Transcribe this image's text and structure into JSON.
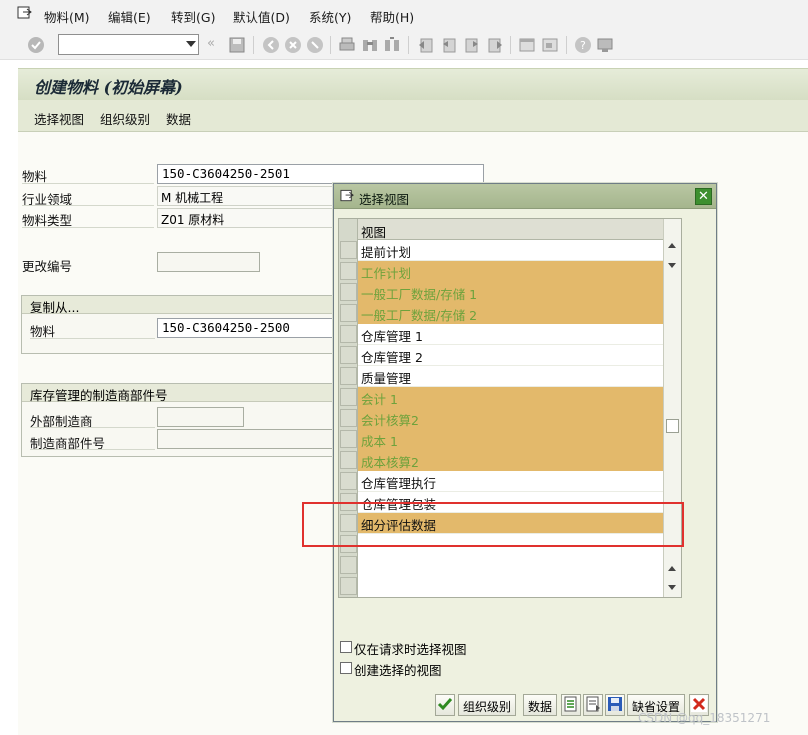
{
  "menubar": {
    "items": [
      "物料(M)",
      "编辑(E)",
      "转到(G)",
      "默认值(D)",
      "系统(Y)",
      "帮助(H)"
    ]
  },
  "toolbar": {
    "command_value": ""
  },
  "title": "创建物料 (初始屏幕)",
  "app_toolbar": {
    "items": [
      "选择视图",
      "组织级别",
      "数据"
    ]
  },
  "form": {
    "material_label": "物料",
    "material_value": "150-C3604250-2501",
    "industry_label": "行业领域",
    "industry_value": "M 机械工程",
    "type_label": "物料类型",
    "type_value": "Z01 原材料",
    "change_no_label": "更改编号",
    "copy_from": {
      "title": "复制从...",
      "material_label": "物料",
      "material_value": "150-C3604250-2500"
    },
    "mpn": {
      "title": "库存管理的制造商部件号",
      "ext_mfr_label": "外部制造商",
      "mpn_label": "制造商部件号"
    }
  },
  "dialog": {
    "title": "选择视图",
    "column_header": "视图",
    "rows": [
      {
        "label": "提前计划",
        "selected": false
      },
      {
        "label": "工作计划",
        "selected": true
      },
      {
        "label": "一般工厂数据/存储 1",
        "selected": true
      },
      {
        "label": "一般工厂数据/存储 2",
        "selected": true
      },
      {
        "label": "仓库管理 1",
        "selected": false
      },
      {
        "label": "仓库管理 2",
        "selected": false
      },
      {
        "label": "质量管理",
        "selected": false
      },
      {
        "label": "会计 1",
        "selected": true
      },
      {
        "label": "会计核算2",
        "selected": true
      },
      {
        "label": "成本 1",
        "selected": true
      },
      {
        "label": "成本核算2",
        "selected": true
      },
      {
        "label": "仓库管理执行",
        "selected": false
      },
      {
        "label": "仓库管理包装",
        "selected": false
      },
      {
        "label": "细分评估数据",
        "selected": true
      }
    ],
    "checkbox_only_on_request": "仅在请求时选择视图",
    "checkbox_create_selected": "创建选择的视图",
    "footer": {
      "org_levels": "组织级别",
      "data": "数据",
      "default_settings": "缺省设置"
    }
  },
  "watermark": "CSDN @qq_18351271",
  "colors": {
    "selected_row": "#e3b96b",
    "selected_text": "#6ea23c",
    "highlight_box": "#e0312e"
  }
}
